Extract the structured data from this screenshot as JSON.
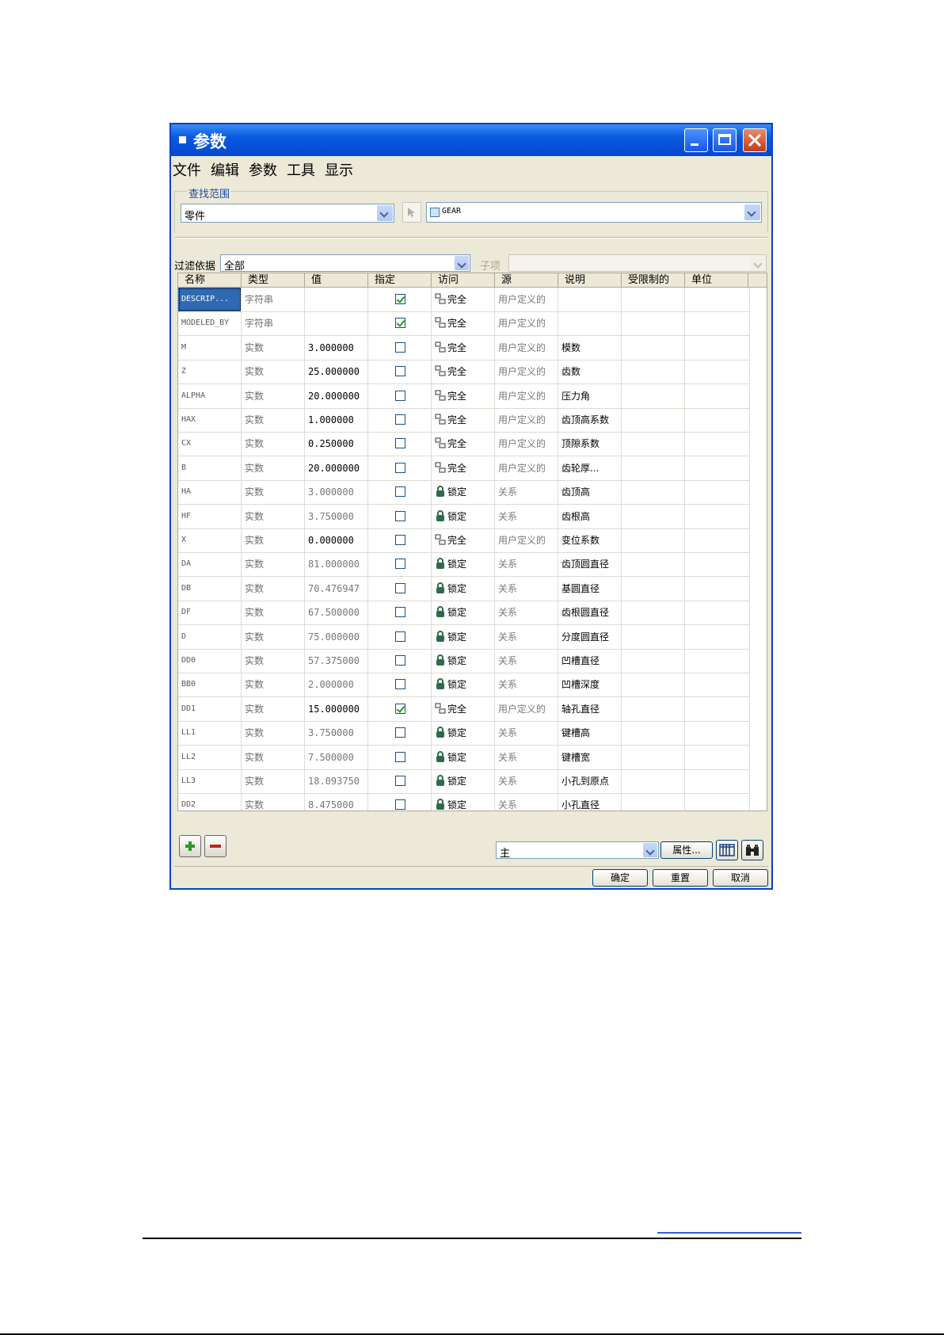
{
  "window": {
    "title": "参数",
    "menu": [
      "文件",
      "编辑",
      "参数",
      "工具",
      "显示"
    ]
  },
  "scope": {
    "label": "查找范围",
    "level_value": "零件",
    "object_value": "GEAR"
  },
  "filter": {
    "label": "过滤依据",
    "value": "全部",
    "sub_label": "子项",
    "sub_value": ""
  },
  "table": {
    "columns": [
      "名称",
      "类型",
      "值",
      "指定",
      "访问",
      "源",
      "说明",
      "受限制的",
      "单位"
    ],
    "rows": [
      {
        "name": "DESCRIP...",
        "type": "字符串",
        "value": "",
        "designate": true,
        "access": "完全",
        "access_icon": "unlocked-icon",
        "source": "用户定义的",
        "desc": "",
        "dim": false
      },
      {
        "name": "MODELED_BY",
        "type": "字符串",
        "value": "",
        "designate": true,
        "access": "完全",
        "access_icon": "unlocked-icon",
        "source": "用户定义的",
        "desc": "",
        "dim": false
      },
      {
        "name": "M",
        "type": "实数",
        "value": "3.000000",
        "designate": false,
        "access": "完全",
        "access_icon": "unlocked-icon",
        "source": "用户定义的",
        "desc": "模数",
        "dim": false
      },
      {
        "name": "Z",
        "type": "实数",
        "value": "25.000000",
        "designate": false,
        "access": "完全",
        "access_icon": "unlocked-icon",
        "source": "用户定义的",
        "desc": "齿数",
        "dim": false
      },
      {
        "name": "ALPHA",
        "type": "实数",
        "value": "20.000000",
        "designate": false,
        "access": "完全",
        "access_icon": "unlocked-icon",
        "source": "用户定义的",
        "desc": "压力角",
        "dim": false
      },
      {
        "name": "HAX",
        "type": "实数",
        "value": "1.000000",
        "designate": false,
        "access": "完全",
        "access_icon": "unlocked-icon",
        "source": "用户定义的",
        "desc": "齿顶高系数",
        "dim": false
      },
      {
        "name": "CX",
        "type": "实数",
        "value": "0.250000",
        "designate": false,
        "access": "完全",
        "access_icon": "unlocked-icon",
        "source": "用户定义的",
        "desc": "顶隙系数",
        "dim": false
      },
      {
        "name": "B",
        "type": "实数",
        "value": "20.000000",
        "designate": false,
        "access": "完全",
        "access_icon": "unlocked-icon",
        "source": "用户定义的",
        "desc": "齿轮厚...",
        "dim": false
      },
      {
        "name": "HA",
        "type": "实数",
        "value": "3.000000",
        "designate": false,
        "access": "锁定",
        "access_icon": "locked-icon",
        "source": "关系",
        "desc": "齿顶高",
        "dim": true
      },
      {
        "name": "HF",
        "type": "实数",
        "value": "3.750000",
        "designate": false,
        "access": "锁定",
        "access_icon": "locked-icon",
        "source": "关系",
        "desc": "齿根高",
        "dim": true
      },
      {
        "name": "X",
        "type": "实数",
        "value": "0.000000",
        "designate": false,
        "access": "完全",
        "access_icon": "unlocked-icon",
        "source": "用户定义的",
        "desc": "变位系数",
        "dim": false
      },
      {
        "name": "DA",
        "type": "实数",
        "value": "81.000000",
        "designate": false,
        "access": "锁定",
        "access_icon": "locked-icon",
        "source": "关系",
        "desc": "齿顶圆直径",
        "dim": true
      },
      {
        "name": "DB",
        "type": "实数",
        "value": "70.476947",
        "designate": false,
        "access": "锁定",
        "access_icon": "locked-icon",
        "source": "关系",
        "desc": "基圆直径",
        "dim": true
      },
      {
        "name": "DF",
        "type": "实数",
        "value": "67.500000",
        "designate": false,
        "access": "锁定",
        "access_icon": "locked-icon",
        "source": "关系",
        "desc": "齿根圆直径",
        "dim": true
      },
      {
        "name": "D",
        "type": "实数",
        "value": "75.000000",
        "designate": false,
        "access": "锁定",
        "access_icon": "locked-icon",
        "source": "关系",
        "desc": "分度圆直径",
        "dim": true
      },
      {
        "name": "DD0",
        "type": "实数",
        "value": "57.375000",
        "designate": false,
        "access": "锁定",
        "access_icon": "locked-icon",
        "source": "关系",
        "desc": "凹槽直径",
        "dim": true
      },
      {
        "name": "BB0",
        "type": "实数",
        "value": "2.000000",
        "designate": false,
        "access": "锁定",
        "access_icon": "locked-icon",
        "source": "关系",
        "desc": "凹槽深度",
        "dim": true
      },
      {
        "name": "DD1",
        "type": "实数",
        "value": "15.000000",
        "designate": true,
        "access": "完全",
        "access_icon": "unlocked-icon",
        "source": "用户定义的",
        "desc": "轴孔直径",
        "dim": false
      },
      {
        "name": "LL1",
        "type": "实数",
        "value": "3.750000",
        "designate": false,
        "access": "锁定",
        "access_icon": "locked-icon",
        "source": "关系",
        "desc": "键槽高",
        "dim": true
      },
      {
        "name": "LL2",
        "type": "实数",
        "value": "7.500000",
        "designate": false,
        "access": "锁定",
        "access_icon": "locked-icon",
        "source": "关系",
        "desc": "键槽宽",
        "dim": true
      },
      {
        "name": "LL3",
        "type": "实数",
        "value": "18.093750",
        "designate": false,
        "access": "锁定",
        "access_icon": "locked-icon",
        "source": "关系",
        "desc": "小孔到原点",
        "dim": true
      },
      {
        "name": "DD2",
        "type": "实数",
        "value": "8.475000",
        "designate": false,
        "access": "锁定",
        "access_icon": "locked-icon",
        "source": "关系",
        "desc": "小孔直径",
        "dim": true
      }
    ]
  },
  "bottom": {
    "view_value": "主",
    "properties_label": "属性...",
    "ok_label": "确定",
    "reset_label": "重置",
    "cancel_label": "取消"
  },
  "colors": {
    "titlebar": "#0a5ae0",
    "window_bg": "#ece9d8",
    "selection": "#3069b3"
  }
}
